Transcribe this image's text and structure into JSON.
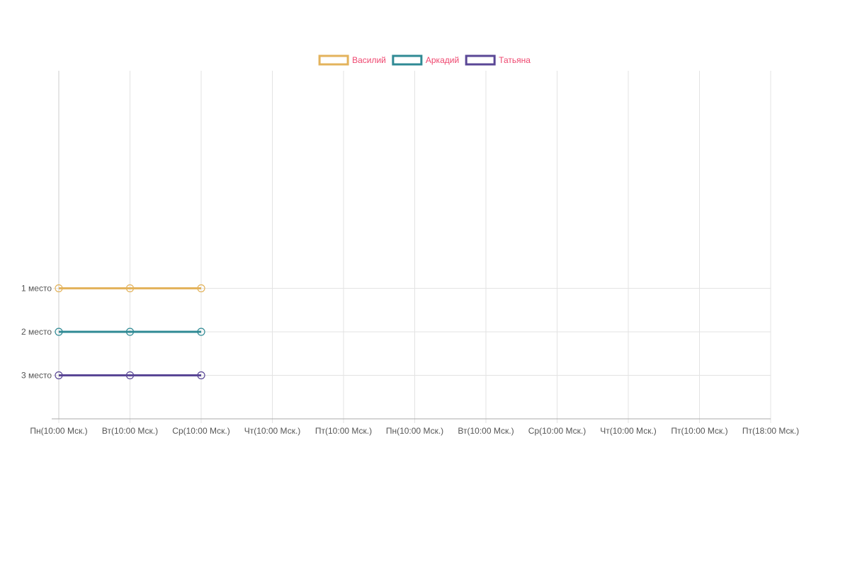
{
  "chart_data": {
    "type": "line",
    "categories": [
      "Пн(10:00 Мск.)",
      "Вт(10:00 Мск.)",
      "Ср(10:00 Мск.)",
      "Чт(10:00 Мск.)",
      "Пт(10:00 Мск.)",
      "Пн(10:00 Мск.)",
      "Вт(10:00 Мск.)",
      "Ср(10:00 Мск.)",
      "Чт(10:00 Мск.)",
      "Пт(10:00 Мск.)",
      "Пт(18:00 Мск.)"
    ],
    "y_ticks": [
      {
        "value": 1,
        "label": "1 место"
      },
      {
        "value": 2,
        "label": "2 место"
      },
      {
        "value": 3,
        "label": "3 место"
      }
    ],
    "ylim": [
      0,
      4
    ],
    "y_reversed": true,
    "grid": true,
    "legend_position": "top-center",
    "series": [
      {
        "name": "Василий",
        "color": "#e3b35c",
        "values": [
          1,
          1,
          1
        ]
      },
      {
        "name": "Аркадий",
        "color": "#2f8a94",
        "values": [
          2,
          2,
          2
        ]
      },
      {
        "name": "Татьяна",
        "color": "#5a4796",
        "values": [
          3,
          3,
          3
        ]
      }
    ],
    "legend_text_color": "#ef476f",
    "grid_color": "#e3e3e3",
    "axis_color": "#aaaaaa"
  }
}
